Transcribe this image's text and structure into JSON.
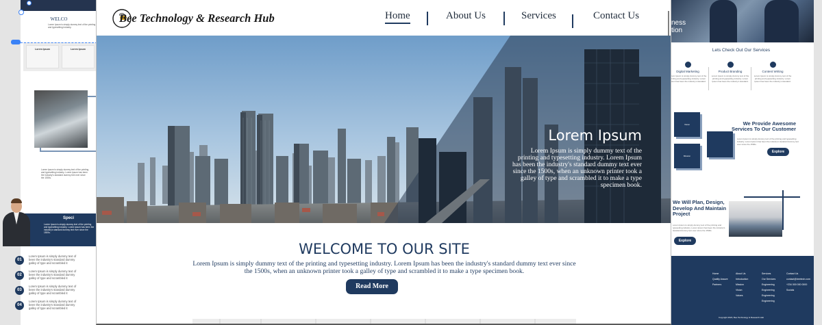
{
  "site": {
    "brand": "Bee Technology & Research Hub",
    "nav": [
      {
        "label": "Home",
        "active": true
      },
      {
        "label": "About Us",
        "active": false
      },
      {
        "label": "Services",
        "active": false
      },
      {
        "label": "Contact Us",
        "active": false
      }
    ],
    "hero": {
      "title": "Lorem Ipsum",
      "text": "Lorem Ipsum is simply dummy text of the printing and typesetting industry. Lorem Ipsum has been the industry's standard dummy text ever since the 1500s, when an unknown printer took a galley of type and scrambled it to make a type specimen book."
    },
    "welcome": {
      "title": "WELCOME TO OUR SITE",
      "text": "Lorem Ipsum is simply dummy text of the printing and typesetting industry. Lorem Ipsum has been the industry's standard dummy text ever since the 1500s, when an unknown printer took a galley of type and scrambled it to make a type specimen book.",
      "button": "Read More"
    }
  },
  "left_artboard": {
    "heading": "WELCO",
    "intro": "Lorem Ipsum is simply dummy text of the printing and typesetting industry.",
    "cards": [
      "Lorem Ipsum",
      "Lorem Ipsum"
    ],
    "caption": "Lorem Ipsum is simply dummy text of the printing and typesetting industry. Lorem Ipsum has been the industry's standard dummy text ever since the 1500s.",
    "band_title": "Speci",
    "band_text": "Lorem Ipsum is simply dummy text of the printing and typesetting industry. Lorem Ipsum has been the industry's standard dummy text ever since the 1500s.",
    "steps": [
      {
        "num": "01",
        "text": "Lorem Ipsum is simply dummy text of been the industry's standard dummy galley of type and scrambled it"
      },
      {
        "num": "02",
        "text": "Lorem Ipsum is simply dummy text of been the industry's standard dummy galley of type and scrambled it"
      },
      {
        "num": "03",
        "text": "Lorem Ipsum is simply dummy text of been the industry's standard dummy galley of type and scrambled it"
      },
      {
        "num": "04",
        "text": "Lorem Ipsum is simply dummy text of been the industry's standard dummy galley of type and scrambled it"
      }
    ]
  },
  "right_artboard": {
    "hero_text": "ness\ntion",
    "services_title": "Lets Check Out Our Services",
    "services": [
      {
        "name": "Digital Marketing",
        "text": "Lorem Ipsum is simply dummy text of the printing and typesetting industry. Lorem Ipsum has been the industry's standard."
      },
      {
        "name": "Product Branding",
        "text": "Lorem Ipsum is simply dummy text of the printing and typesetting industry. Lorem Ipsum has been the industry's standard."
      },
      {
        "name": "Content Writing",
        "text": "Lorem Ipsum is simply dummy text of the printing and typesetting industry. Lorem Ipsum has been the industry's standard."
      }
    ],
    "boxes": [
      "Vision",
      "Mission"
    ],
    "provide_title": "We Provide Awesome Services To Our Customer",
    "provide_text": "Lorem Ipsum is simply dummy text of the printing and typesetting industry. Lorem Ipsum has been the industry's standard dummy text ever since the 1500s.",
    "explore": "Explore",
    "plan_title": "We Will Plan, Design, Develop And Maintain Project",
    "plan_text": "Lorem Ipsum is simply dummy text of the printing and typesetting industry. Lorem Ipsum has been the industry's standard dummy text ever since the 1500s.",
    "footer_cols": [
      [
        "Home",
        "Quality Assure",
        "Partners"
      ],
      [
        "About Us",
        "Introduction",
        "Mission",
        "Vision",
        "Values"
      ],
      [
        "Services",
        "Our Services",
        "Engineering",
        "Engineering",
        "Engineering",
        "Engineering"
      ],
      [
        "Contact Us",
        "contact@beetech.com",
        "+234 000 000 0000",
        "Socials"
      ]
    ],
    "footer_copy": "Copyright 2023, Bee Technology & Research Hub"
  },
  "colors": {
    "navy": "#1f3a5f",
    "white": "#ffffff",
    "canvas": "#e4e4e4",
    "selection": "#3b82f6"
  }
}
